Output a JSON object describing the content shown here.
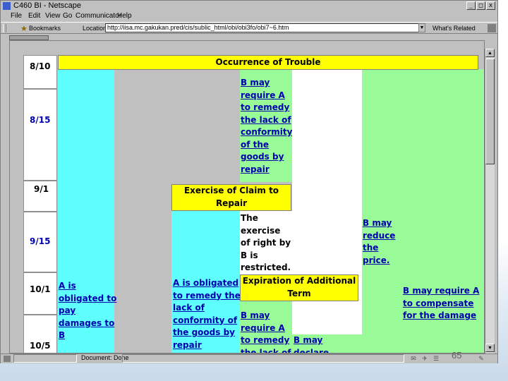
{
  "window": {
    "title": "C460 BI - Netscape",
    "controls": [
      "_",
      "□",
      "x"
    ]
  },
  "menu": [
    "File",
    "Edit",
    "View",
    "Go",
    "Communicator",
    "Help"
  ],
  "toolbar": {
    "bookmarks_label": "Bookmarks",
    "location_label": "Location:",
    "url": "http://iisa.mc.gakukan.pred/cis/sublic_html/obi/obi3fo/obi7~6.htm",
    "whats_related_label": "What's Related"
  },
  "dates": [
    "8/10",
    "8/15",
    "9/1",
    "9/15",
    "10/1",
    "10/5"
  ],
  "table": {
    "occurrence_header": "Occurrence of Trouble",
    "b_may_require_remedy": "B may require A to remedy the lack of conformity of the goods by repair",
    "exercise_header": "Exercise of Claim to Repair",
    "exercise_restricted": "The exercise of right by B is restricted.",
    "b_may_reduce": "B may reduce the price.",
    "a_obligated_damages": "A is obligated to pay damages to B",
    "a_obligated_remedy": "A is obligated to remedy the lack of conformity of the goods by repair",
    "expiration_header": "Expiration of Additional Term",
    "b_may_require_compensate": "B may require A to compensate for the damage",
    "b_may_require_remedy_2": "B may require A to remedy the lack of conformity",
    "b_may_declare": "B may declare"
  },
  "status": {
    "text": "Document: Done"
  },
  "slide": {
    "page_number": "65"
  }
}
